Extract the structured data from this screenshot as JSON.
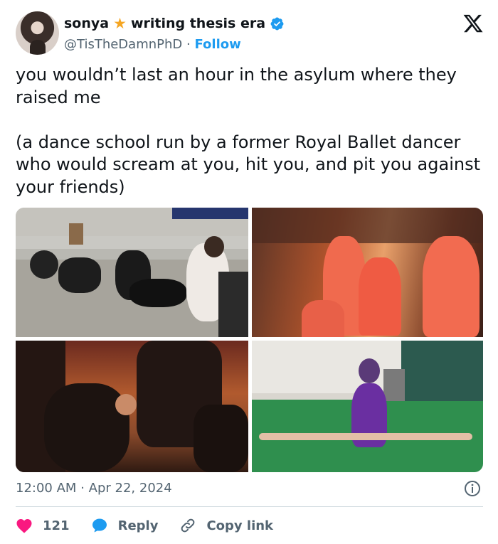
{
  "author": {
    "name": "sonya",
    "name_suffix": "writing thesis era",
    "handle": "@TisTheDamnPhD",
    "separator": "·",
    "follow_label": "Follow"
  },
  "tweet": {
    "text": "you wouldn’t last an hour in the asylum where they raised me\n\n(a dance school run by a former Royal Ballet dancer who would scream at you, hit you, and pit you against your friends)"
  },
  "media": {
    "count": 4
  },
  "meta": {
    "time": "12:00 AM",
    "separator": "·",
    "date": "Apr 22, 2024"
  },
  "actions": {
    "likes_count": "121",
    "reply_label": "Reply",
    "copy_link_label": "Copy link"
  },
  "colors": {
    "accent": "#1d9bf0",
    "like": "#f91880",
    "muted": "#536471",
    "star": "#f5a623"
  },
  "icons": [
    "x-logo-icon",
    "star-icon",
    "verified-badge-icon",
    "info-icon",
    "heart-icon",
    "reply-bubble-icon",
    "link-icon"
  ]
}
